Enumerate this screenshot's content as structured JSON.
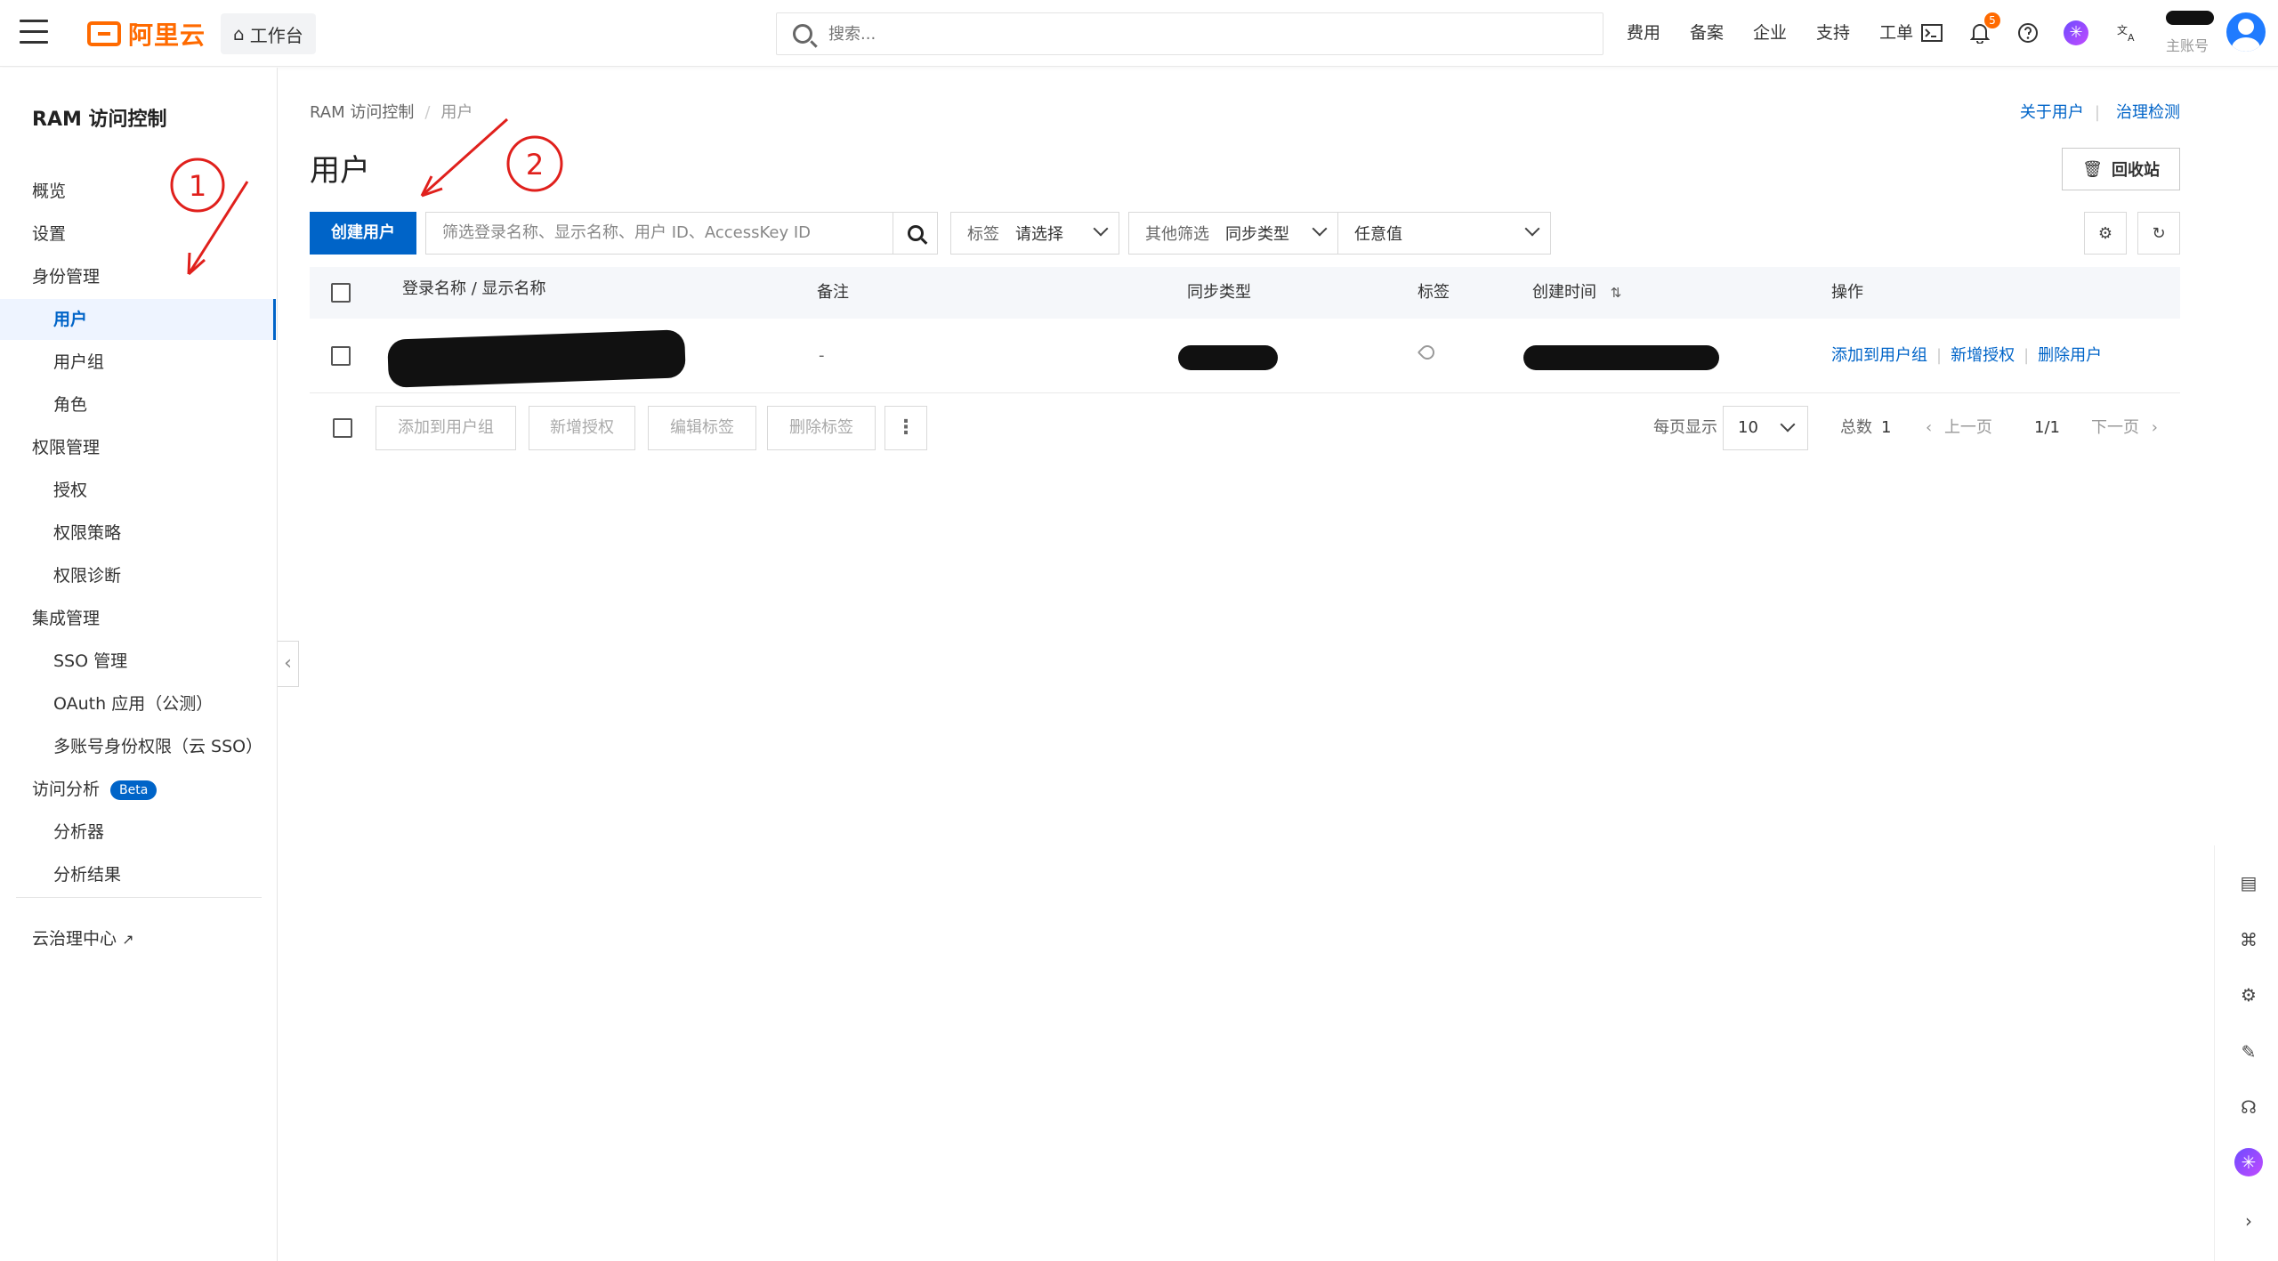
{
  "header": {
    "brand": "阿里云",
    "workbench": "工作台",
    "search_placeholder": "搜索...",
    "nav": [
      "费用",
      "备案",
      "企业",
      "支持",
      "工单"
    ],
    "notification_count": "5",
    "account_label": "主账号"
  },
  "sidebar": {
    "title": "RAM 访问控制",
    "items": [
      {
        "label": "概览",
        "level": 0
      },
      {
        "label": "设置",
        "level": 0
      },
      {
        "label": "身份管理",
        "level": 0
      },
      {
        "label": "用户",
        "level": 1,
        "active": true
      },
      {
        "label": "用户组",
        "level": 1
      },
      {
        "label": "角色",
        "level": 1
      },
      {
        "label": "权限管理",
        "level": 0
      },
      {
        "label": "授权",
        "level": 1
      },
      {
        "label": "权限策略",
        "level": 1
      },
      {
        "label": "权限诊断",
        "level": 1
      },
      {
        "label": "集成管理",
        "level": 0
      },
      {
        "label": "SSO 管理",
        "level": 1
      },
      {
        "label": "OAuth 应用（公测）",
        "level": 1
      },
      {
        "label": "多账号身份权限（云 SSO）",
        "level": 1
      },
      {
        "label": "访问分析",
        "level": 0,
        "badge": "Beta"
      },
      {
        "label": "分析器",
        "level": 1
      },
      {
        "label": "分析结果",
        "level": 1
      }
    ],
    "footer_link": "云治理中心"
  },
  "main": {
    "breadcrumb": [
      "RAM 访问控制",
      "用户"
    ],
    "top_links": [
      "关于用户",
      "治理检测"
    ],
    "title": "用户",
    "recycle_label": "回收站",
    "create_user_label": "创建用户",
    "search_placeholder": "筛选登录名称、显示名称、用户 ID、AccessKey ID",
    "tag_filter": {
      "label": "标签",
      "value": "请选择"
    },
    "other_filter": {
      "label": "其他筛选",
      "value": "同步类型"
    },
    "any_value": "任意值"
  },
  "table": {
    "columns": [
      "登录名称 / 显示名称",
      "备注",
      "同步类型",
      "标签",
      "创建时间",
      "操作"
    ],
    "sort_icon": "⇅",
    "rows": [
      {
        "remark": "-",
        "actions": [
          "添加到用户组",
          "新增授权",
          "删除用户"
        ]
      }
    ]
  },
  "footer": {
    "bulk_actions": [
      "添加到用户组",
      "新增授权",
      "编辑标签",
      "删除标签"
    ],
    "per_page_label": "每页显示",
    "per_page_value": "10",
    "total_label": "总数",
    "total_value": "1",
    "prev_label": "上一页",
    "page_indicator": "1/1",
    "next_label": "下一页"
  },
  "annotations": {
    "step1": "1",
    "step2": "2"
  },
  "colors": {
    "brand": "#ff6a00",
    "primary": "#0064c8",
    "annotation": "#e0201c"
  }
}
